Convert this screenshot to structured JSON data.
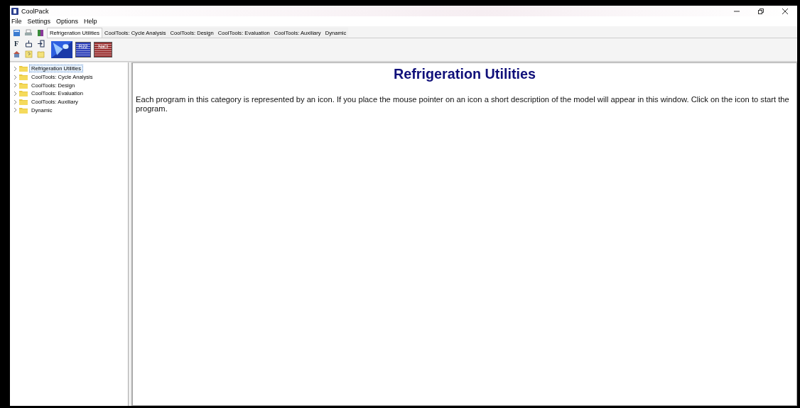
{
  "window": {
    "title": "CoolPack"
  },
  "menu": [
    "File",
    "Settings",
    "Options",
    "Help"
  ],
  "tools": [
    {
      "kind": "calc"
    },
    {
      "kind": "print"
    },
    {
      "kind": "pill"
    },
    {
      "kind": "letter",
      "label": "F"
    },
    {
      "kind": "tree"
    },
    {
      "kind": "exit"
    },
    {
      "kind": "house"
    },
    {
      "kind": "help"
    },
    {
      "kind": "book"
    }
  ],
  "tabs": [
    {
      "label": "Refrigeration Utilities",
      "selected": true
    },
    {
      "label": "CoolTools: Cycle Analysis",
      "selected": false
    },
    {
      "label": "CoolTools: Design",
      "selected": false
    },
    {
      "label": "CoolTools: Evaluation",
      "selected": false
    },
    {
      "label": "CoolTools: Auxiliary",
      "selected": false
    },
    {
      "label": "Dynamic",
      "selected": false
    }
  ],
  "programs": [
    {
      "kind": "picture"
    },
    {
      "kind": "table",
      "label": "R22",
      "color": "#2a3db8"
    },
    {
      "kind": "table",
      "label": "NaCl",
      "color": "#9a3030"
    }
  ],
  "tree": [
    {
      "label": "Refrigeration Utilities",
      "selected": true,
      "expanded": false
    },
    {
      "label": "CoolTools: Cycle Analysis",
      "selected": false,
      "expanded": false
    },
    {
      "label": "CoolTools: Design",
      "selected": false,
      "expanded": false
    },
    {
      "label": "CoolTools: Evaluation",
      "selected": false,
      "expanded": false
    },
    {
      "label": "CoolTools: Auxiliary",
      "selected": false,
      "expanded": false
    },
    {
      "label": "Dynamic",
      "selected": false,
      "expanded": false
    }
  ],
  "content": {
    "heading": "Refrigeration Utilities",
    "text": "Each program in this category is represented by an icon. If you place the mouse pointer on an icon a short description of the model will appear in this window. Click on the icon to start the program."
  }
}
